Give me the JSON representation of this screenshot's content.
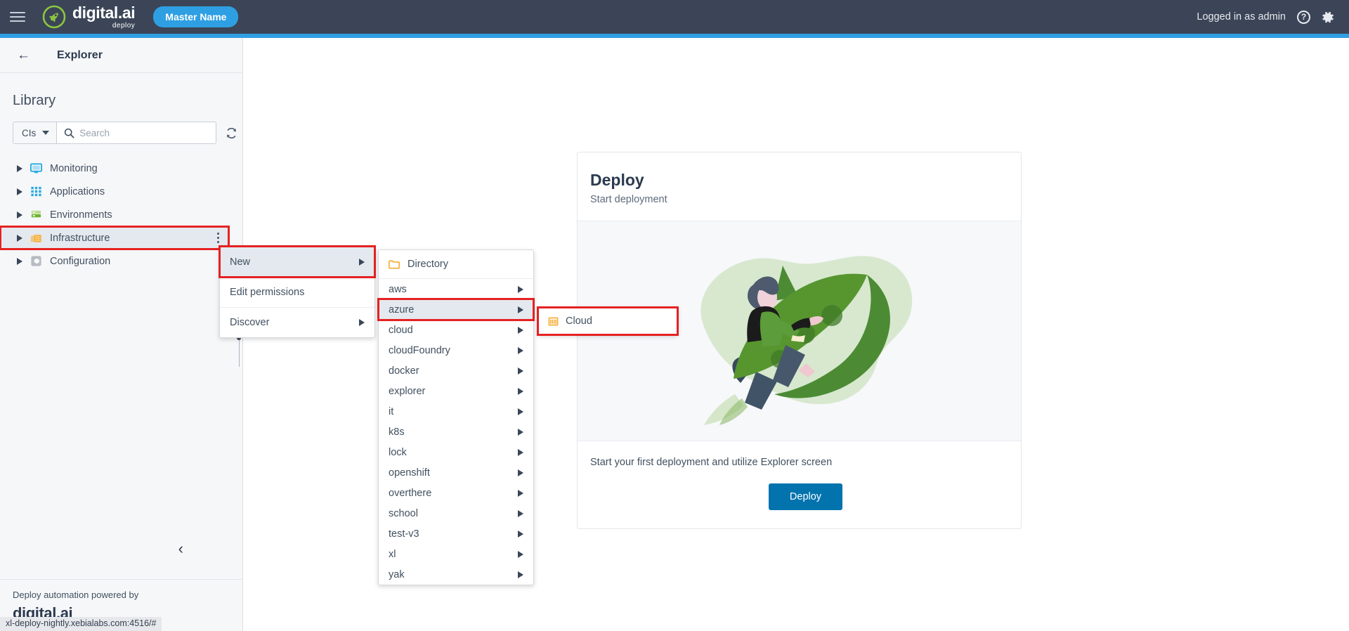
{
  "topbar": {
    "menu_icon": "hamburger-icon",
    "brand_word": "digital.ai",
    "brand_sub": "deploy",
    "master_pill": "Master Name",
    "logged_in": "Logged in as admin",
    "help_icon": "?",
    "gear_icon": "gear-icon",
    "bg_color": "#3b4557",
    "accent_color": "#2f9fe3"
  },
  "sidebar": {
    "back_label": "←",
    "title": "Explorer",
    "library_title": "Library",
    "search": {
      "filter_label": "CIs",
      "placeholder": "Search",
      "value": "",
      "refresh_icon": "refresh-icon"
    },
    "tree": [
      {
        "label": "Monitoring",
        "icon": "monitor-icon"
      },
      {
        "label": "Applications",
        "icon": "grid-icon"
      },
      {
        "label": "Environments",
        "icon": "server-icon"
      },
      {
        "label": "Infrastructure",
        "icon": "building-icon"
      },
      {
        "label": "Configuration",
        "icon": "gear-icon"
      }
    ],
    "collapse_icon": "chevron-left-icon",
    "footer_text": "Deploy automation powered by",
    "footer_brand": "digital.ai"
  },
  "statusbar": {
    "url": "xl-deploy-nightly.xebialabs.com:4516/#"
  },
  "card": {
    "title": "Deploy",
    "subtitle": "Start deployment",
    "illustration": "rocket-rider-illustration",
    "footer_text": "Start your first deployment and utilize Explorer screen",
    "button_label": "Deploy",
    "button_color": "#0273ad"
  },
  "context_menu": {
    "items": [
      {
        "label": "New",
        "has_submenu": true
      },
      {
        "label": "Edit permissions",
        "has_submenu": false
      },
      {
        "label": "Discover",
        "has_submenu": true
      }
    ]
  },
  "new_submenu": {
    "directory_label": "Directory",
    "directory_icon": "folder-icon",
    "items": [
      "aws",
      "azure",
      "cloud",
      "cloudFoundry",
      "docker",
      "explorer",
      "it",
      "k8s",
      "lock",
      "openshift",
      "overthere",
      "school",
      "test-v3",
      "xl",
      "yak"
    ]
  },
  "azure_submenu": {
    "items": [
      {
        "label": "Cloud",
        "icon": "cloud-grid-icon"
      }
    ]
  },
  "highlight_color": "#e52222"
}
